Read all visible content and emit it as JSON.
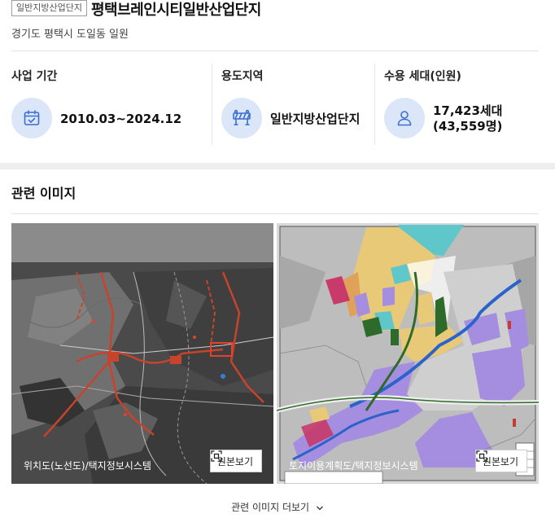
{
  "header": {
    "badge": "일반지방산업단지",
    "title": "평택브레인시티일반산업단지",
    "address": "경기도 평택시 도일동 일원"
  },
  "stats": [
    {
      "label": "사업 기간",
      "value": "2010.03~2024.12",
      "icon": "calendar-icon"
    },
    {
      "label": "용도지역",
      "value": "일반지방산업단지",
      "icon": "barrier-icon"
    },
    {
      "label": "수용 세대(인원)",
      "value_line1": "17,423세대",
      "value_line2": "(43,559명)",
      "icon": "person-icon"
    }
  ],
  "related": {
    "title": "관련 이미지",
    "images": [
      {
        "caption": "위치도(노선도)/택지정보시스템",
        "button": "원본보기"
      },
      {
        "caption": "토지이용계획도/택지정보시스템",
        "button": "원본보기"
      }
    ],
    "more_label": "관련 이미지 더보기"
  },
  "colors": {
    "icon_circle": "#dbe7f8",
    "icon_stroke": "#3b6fd1",
    "route_red": "#c8432b",
    "industrial_purple": "#a58ee0",
    "residential_yellow": "#e8c978",
    "water_blue": "#2a63c9",
    "green_buffer": "#2e6b2a",
    "cyan_zone": "#5fc7c9"
  }
}
